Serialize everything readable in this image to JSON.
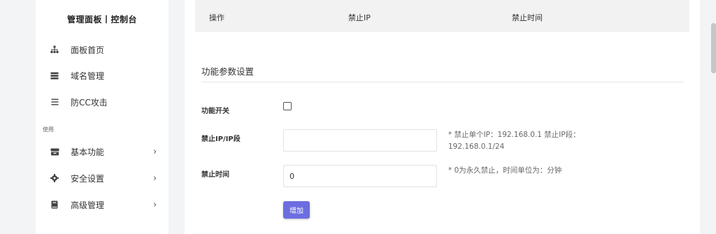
{
  "sidebar": {
    "brand": "管理面板丨控制台",
    "section_label": "使用",
    "items": [
      {
        "label": "面板首页",
        "icon": "sitemap-icon"
      },
      {
        "label": "域名管理",
        "icon": "server-icon"
      },
      {
        "label": "防CC攻击",
        "icon": "list-icon"
      },
      {
        "label": "基本功能",
        "icon": "inbox-icon",
        "arrow": "›"
      },
      {
        "label": "安全设置",
        "icon": "gear-icon",
        "arrow": "›"
      },
      {
        "label": "高级管理",
        "icon": "book-icon",
        "arrow": "›"
      }
    ]
  },
  "table": {
    "columns": [
      "操作",
      "禁止IP",
      "禁止时间"
    ]
  },
  "settings": {
    "title": "功能参数设置",
    "switch_label": "功能开关",
    "ip_label": "禁止IP/IP段",
    "ip_value": "",
    "ip_hint_line1": "* 禁止单个IP：192.168.0.1   禁止IP段：",
    "ip_hint_line2": "192.168.0.1/24",
    "time_label": "禁止时间",
    "time_value": "0",
    "time_hint": "* 0为永久禁止，时间单位为：分钟",
    "add_button": "增加"
  },
  "colors": {
    "accent": "#6c6ee0",
    "background": "#f3f4f6"
  }
}
